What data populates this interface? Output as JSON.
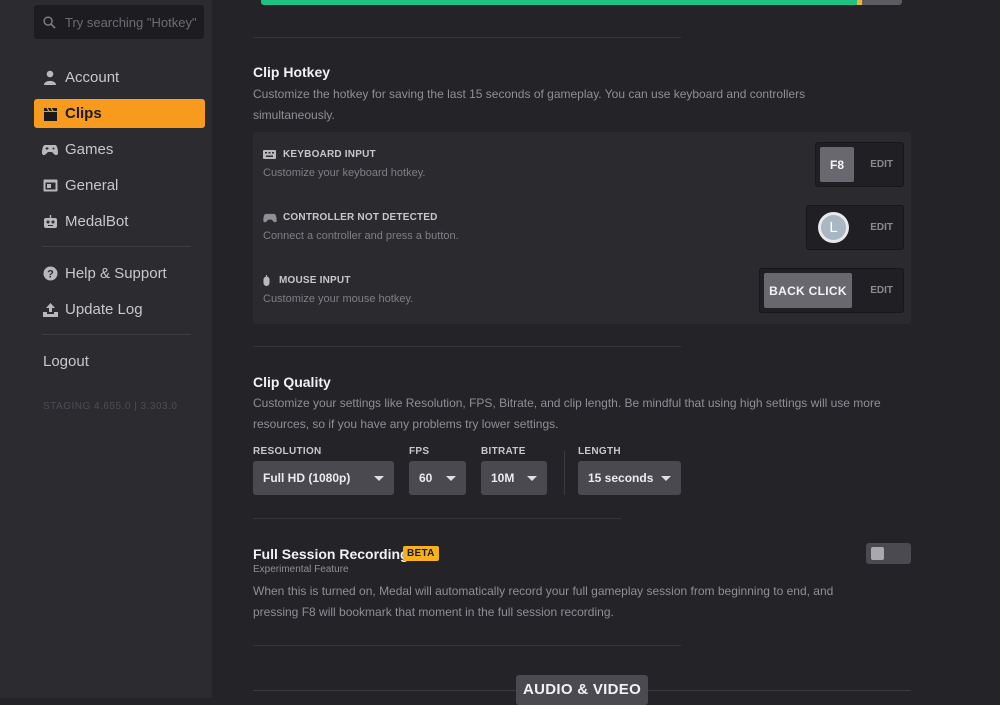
{
  "sidebar": {
    "search_placeholder": "Try searching \"Hotkey\"",
    "items": [
      {
        "label": "Account",
        "icon": "user-icon"
      },
      {
        "label": "Clips",
        "icon": "clapperboard-icon",
        "active": true
      },
      {
        "label": "Games",
        "icon": "gamepad-icon"
      },
      {
        "label": "General",
        "icon": "window-icon"
      },
      {
        "label": "MedalBot",
        "icon": "robot-icon"
      }
    ],
    "help_label": "Help & Support",
    "update_log_label": "Update Log",
    "logout_label": "Logout",
    "version": "STAGING 4.655.0 | 3.303.0",
    "accent_color": "#f79a1e"
  },
  "top_progress": {
    "fraction": 0.93,
    "color": "#1fc283"
  },
  "clip_hotkey": {
    "title": "Clip Hotkey",
    "description": "Customize the hotkey for saving the last 15 seconds of gameplay. You can use keyboard and controllers simultaneously.",
    "keyboard": {
      "title": "KEYBOARD INPUT",
      "subtitle": "Customize your keyboard hotkey.",
      "key": "F8",
      "edit": "EDIT"
    },
    "controller": {
      "title": "CONTROLLER NOT DETECTED",
      "subtitle": "Connect a controller and press a button.",
      "key": "L",
      "edit": "EDIT"
    },
    "mouse": {
      "title": "MOUSE INPUT",
      "subtitle": "Customize your mouse hotkey.",
      "key": "BACK CLICK",
      "edit": "EDIT"
    }
  },
  "clip_quality": {
    "title": "Clip Quality",
    "description": "Customize your settings like Resolution, FPS, Bitrate, and clip length. Be mindful that using high settings will use more resources, so if you have any problems try lower settings.",
    "resolution": {
      "label": "RESOLUTION",
      "value": "Full HD (1080p)"
    },
    "fps": {
      "label": "FPS",
      "value": "60"
    },
    "bitrate": {
      "label": "BITRATE",
      "value": "10M"
    },
    "length": {
      "label": "LENGTH",
      "value": "15 seconds"
    }
  },
  "full_session": {
    "title": "Full Session Recording",
    "badge": "BETA",
    "subtitle": "Experimental Feature",
    "description": "When this is turned on, Medal will automatically record your full gameplay session from beginning to end, and pressing F8 will bookmark that moment in the full session recording.",
    "enabled": false
  },
  "section_label": "AUDIO & VIDEO"
}
